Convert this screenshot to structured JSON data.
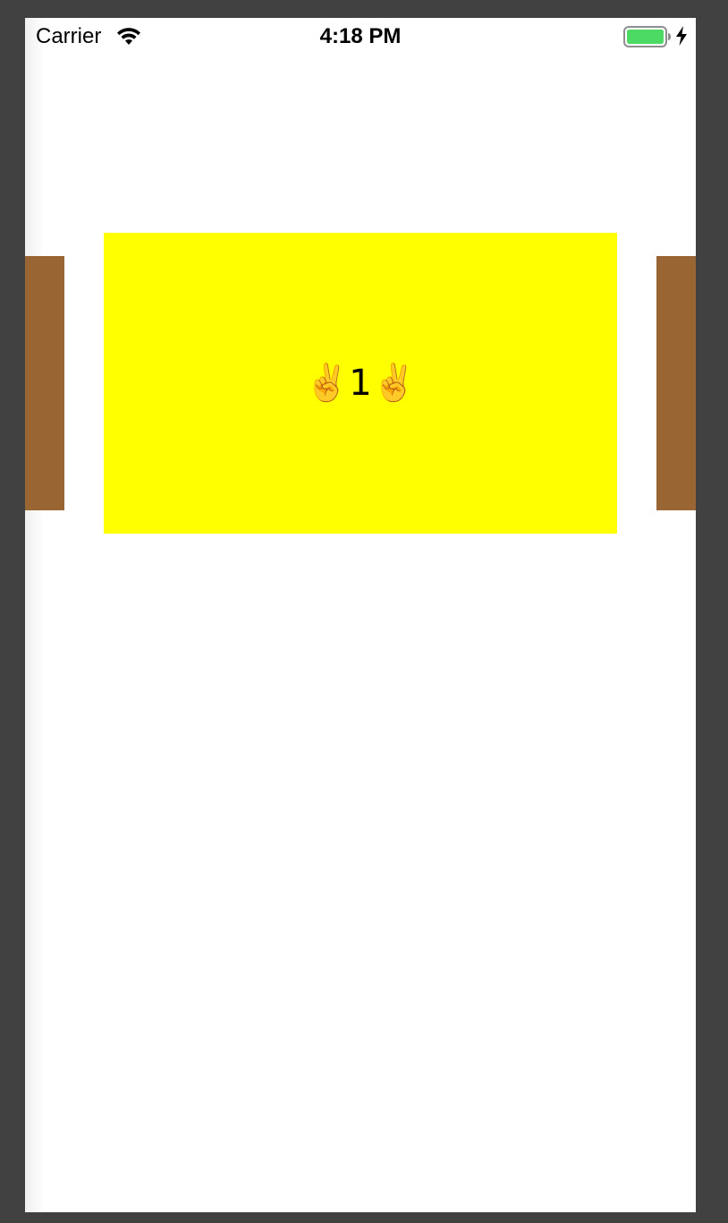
{
  "status_bar": {
    "carrier": "Carrier",
    "time": "4:18 PM",
    "icons": [
      "wifi-icon",
      "battery-icon",
      "charging-icon"
    ],
    "battery_color": "#4cd964"
  },
  "carousel": {
    "current_card": {
      "label": "✌️1✌️",
      "color": "#ffff00"
    },
    "side_card_color": "#996633"
  }
}
